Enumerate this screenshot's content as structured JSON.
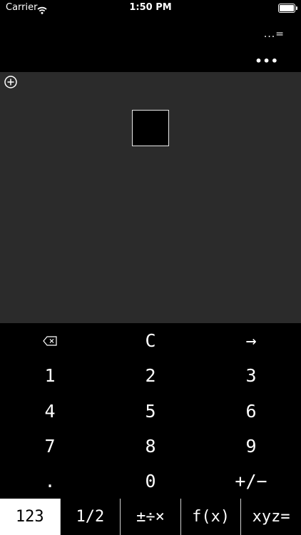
{
  "status": {
    "carrier": "Carrier",
    "time": "1:50 PM",
    "icons": [
      "wifi-icon",
      "battery-icon"
    ]
  },
  "result": {
    "mark": "...=",
    "more": "•••"
  },
  "canvas": {
    "icons": [
      "add-circle-icon"
    ]
  },
  "keypad": {
    "rows": [
      [
        "⌫",
        "C",
        "→"
      ],
      [
        "1",
        "2",
        "3"
      ],
      [
        "4",
        "5",
        "6"
      ],
      [
        "7",
        "8",
        "9"
      ],
      [
        ".",
        "0",
        "+/−"
      ]
    ]
  },
  "tabs": [
    {
      "label": "123",
      "active": true
    },
    {
      "label": "1/2",
      "active": false
    },
    {
      "label": "±÷×",
      "active": false
    },
    {
      "label": "f(x)",
      "active": false
    },
    {
      "label": "xyz=",
      "active": false
    }
  ],
  "colors": {
    "background": "#000000",
    "canvas": "#2b2b2b",
    "foreground": "#ffffff"
  }
}
